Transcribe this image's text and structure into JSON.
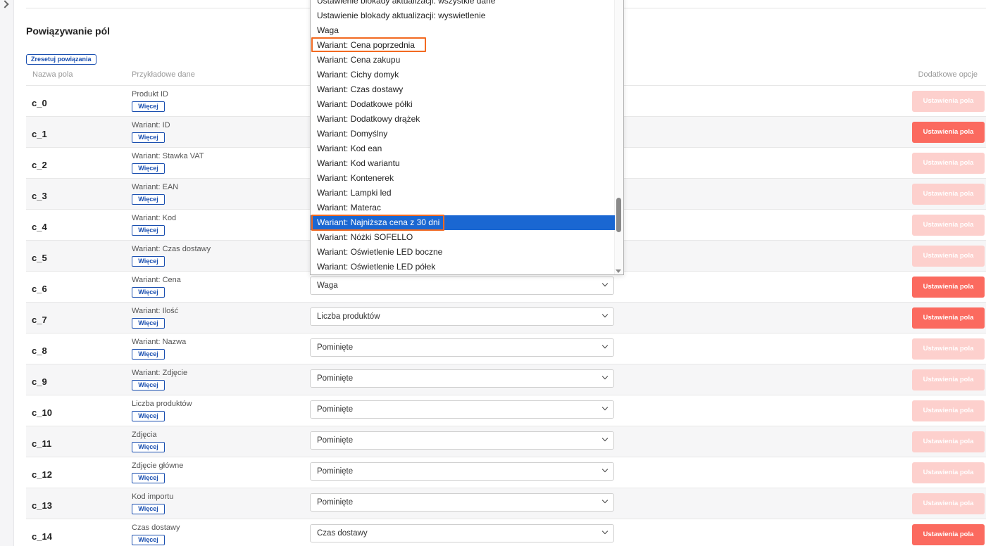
{
  "section": {
    "title": "Powiązywanie pól",
    "reset_label": "Zresetuj powiązania"
  },
  "headers": {
    "name": "Nazwa pola",
    "sample": "Przykładowe dane",
    "options": "Dodatkowe opcje"
  },
  "more_label": "Więcej",
  "options_label": "Ustawienia pola",
  "rows": [
    {
      "field": "c_0",
      "sample": "Produkt ID",
      "mapping": "",
      "active": false
    },
    {
      "field": "c_1",
      "sample": "Wariant: ID",
      "mapping": "",
      "active": true
    },
    {
      "field": "c_2",
      "sample": "Wariant: Stawka VAT",
      "mapping": "",
      "active": false
    },
    {
      "field": "c_3",
      "sample": "Wariant: EAN",
      "mapping": "",
      "active": false
    },
    {
      "field": "c_4",
      "sample": "Wariant: Kod",
      "mapping": "",
      "active": false
    },
    {
      "field": "c_5",
      "sample": "Wariant: Czas dostawy",
      "mapping": "",
      "active": false
    },
    {
      "field": "c_6",
      "sample": "Wariant: Cena",
      "mapping": "Waga",
      "active": true
    },
    {
      "field": "c_7",
      "sample": "Wariant: Ilość",
      "mapping": "Liczba produktów",
      "active": true
    },
    {
      "field": "c_8",
      "sample": "Wariant: Nazwa",
      "mapping": "Pominięte",
      "active": false
    },
    {
      "field": "c_9",
      "sample": "Wariant: Zdjęcie",
      "mapping": "Pominięte",
      "active": false
    },
    {
      "field": "c_10",
      "sample": "Liczba produktów",
      "mapping": "Pominięte",
      "active": false
    },
    {
      "field": "c_11",
      "sample": "Zdjęcia",
      "mapping": "Pominięte",
      "active": false
    },
    {
      "field": "c_12",
      "sample": "Zdjęcie główne",
      "mapping": "Pominięte",
      "active": false
    },
    {
      "field": "c_13",
      "sample": "Kod importu",
      "mapping": "Pominięte",
      "active": false
    },
    {
      "field": "c_14",
      "sample": "Czas dostawy",
      "mapping": "Czas dostawy",
      "active": true
    }
  ],
  "dropdown": {
    "items": [
      "Ustawienie blokady aktualizacji: wszystkie dane",
      "Ustawienie blokady aktualizacji: wyswietlenie",
      "Waga",
      "Wariant: Cena poprzednia",
      "Wariant: Cena zakupu",
      "Wariant: Cichy domyk",
      "Wariant: Czas dostawy",
      "Wariant: Dodatkowe półki",
      "Wariant: Dodatkowy drążek",
      "Wariant: Domyślny",
      "Wariant: Kod ean",
      "Wariant: Kod wariantu",
      "Wariant: Kontenerek",
      "Wariant: Lampki led",
      "Wariant: Materac",
      "Wariant: Najniższa cena z 30 dni",
      "Wariant: Nóżki SOFELLO",
      "Wariant: Oświetlenie LED boczne",
      "Wariant: Oświetlenie LED półek"
    ],
    "selected": "Wariant: Najniższa cena z 30 dni"
  },
  "colors": {
    "accent_blue": "#1a4fb0",
    "selected_blue": "#1a67d2",
    "button_active": "#fb6a5f",
    "button_disabled": "#fdd0cd",
    "highlight": "#f26a21"
  }
}
